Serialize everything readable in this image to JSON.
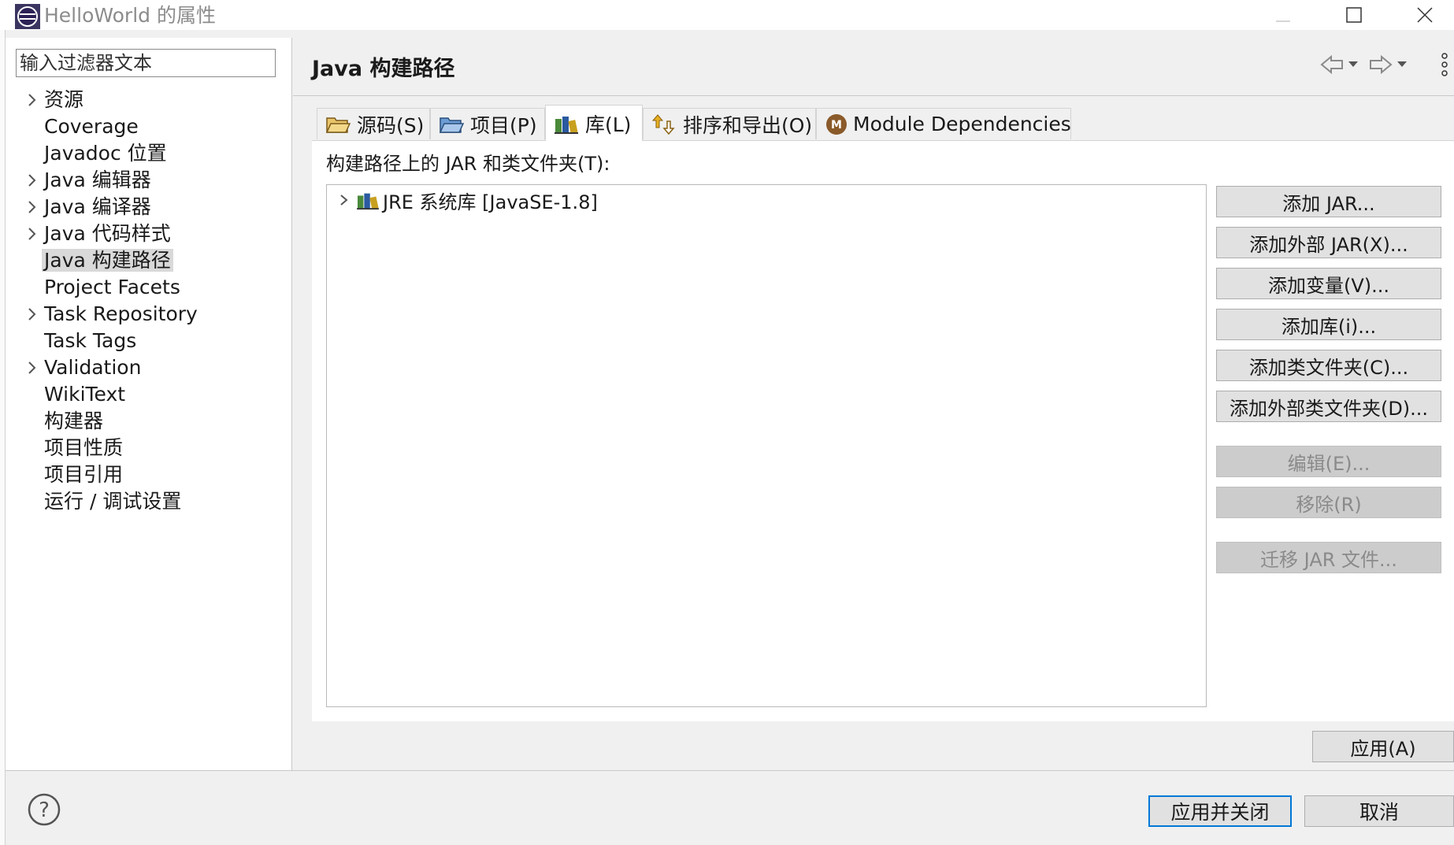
{
  "window": {
    "title": "HelloWorld 的属性",
    "controls": [
      "minimize",
      "maximize",
      "close"
    ]
  },
  "sidebar": {
    "filter_placeholder": "输入过滤器文本",
    "items": [
      {
        "label": "资源",
        "expandable": true
      },
      {
        "label": "Coverage",
        "expandable": false
      },
      {
        "label": "Javadoc 位置",
        "expandable": false
      },
      {
        "label": "Java 编辑器",
        "expandable": true
      },
      {
        "label": "Java 编译器",
        "expandable": true
      },
      {
        "label": "Java 代码样式",
        "expandable": true
      },
      {
        "label": "Java 构建路径",
        "expandable": false,
        "selected": true
      },
      {
        "label": "Project Facets",
        "expandable": false
      },
      {
        "label": "Task Repository",
        "expandable": true
      },
      {
        "label": "Task Tags",
        "expandable": false
      },
      {
        "label": "Validation",
        "expandable": true
      },
      {
        "label": "WikiText",
        "expandable": false
      },
      {
        "label": "构建器",
        "expandable": false
      },
      {
        "label": "项目性质",
        "expandable": false
      },
      {
        "label": "项目引用",
        "expandable": false
      },
      {
        "label": "运行 / 调试设置",
        "expandable": false
      }
    ]
  },
  "main": {
    "title": "Java 构建路径",
    "tabs": [
      {
        "label": "源码(S)",
        "icon": "source-folder-icon"
      },
      {
        "label": "项目(P)",
        "icon": "project-folder-icon"
      },
      {
        "label": "库(L)",
        "icon": "library-books-icon",
        "active": true
      },
      {
        "label": "排序和导出(O)",
        "icon": "order-export-icon"
      },
      {
        "label": "Module Dependencies",
        "icon": "module-icon"
      }
    ],
    "list_label": "构建路径上的 JAR 和类文件夹(T):",
    "libraries": [
      {
        "label": "JRE 系统库 [JavaSE-1.8]",
        "icon": "library-books-icon"
      }
    ],
    "buttons": [
      {
        "label": "添加 JAR...",
        "enabled": true
      },
      {
        "label": "添加外部 JAR(X)...",
        "enabled": true
      },
      {
        "label": "添加变量(V)...",
        "enabled": true
      },
      {
        "label": "添加库(i)...",
        "enabled": true
      },
      {
        "label": "添加类文件夹(C)...",
        "enabled": true
      },
      {
        "label": "添加外部类文件夹(D)...",
        "enabled": true
      },
      {
        "label": "编辑(E)...",
        "enabled": false
      },
      {
        "label": "移除(R)",
        "enabled": false
      },
      {
        "label": "迁移 JAR 文件...",
        "enabled": false
      }
    ],
    "apply_label": "应用(A)"
  },
  "footer": {
    "apply_close_label": "应用并关闭",
    "cancel_label": "取消"
  },
  "colors": {
    "focus_border": "#0078d7",
    "selected_bg": "#d9d9d9",
    "disabled_text": "#8a8a8a"
  }
}
